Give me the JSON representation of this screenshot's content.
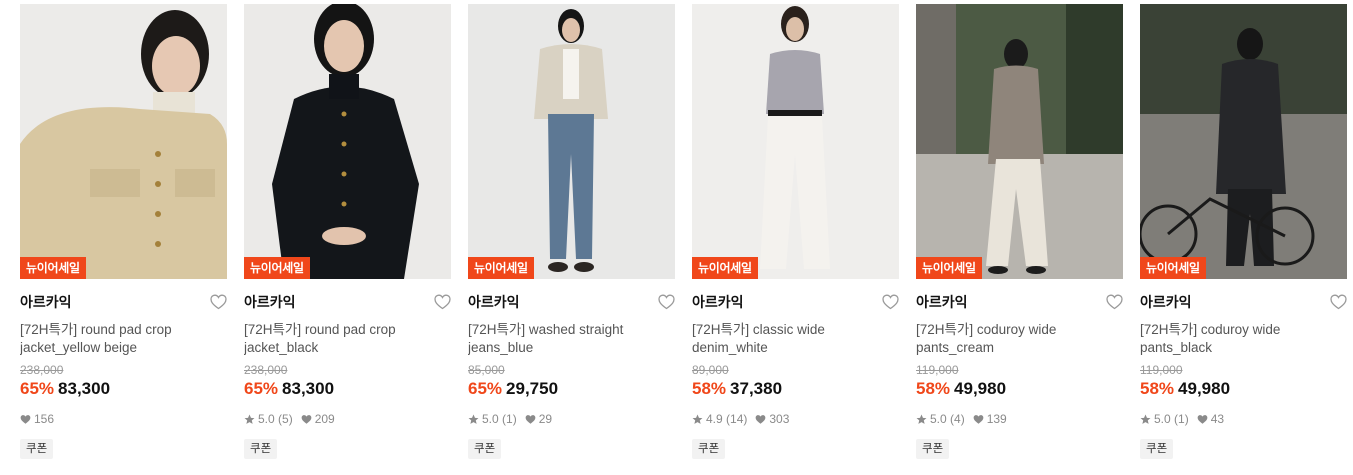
{
  "colors": {
    "accent": "#f0471a",
    "muted": "#8a8a8a"
  },
  "products": [
    {
      "badge": "뉴이어세일",
      "brand": "아르카익",
      "title": "[72H특가] round pad crop jacket_yellow beige",
      "original_price": "238,000",
      "discount": "65%",
      "price": "83,300",
      "rating": "",
      "reviews": "",
      "likes": "156",
      "coupon": "쿠폰"
    },
    {
      "badge": "뉴이어세일",
      "brand": "아르카익",
      "title": "[72H특가] round pad crop jacket_black",
      "original_price": "238,000",
      "discount": "65%",
      "price": "83,300",
      "rating": "5.0",
      "reviews": "(5)",
      "likes": "209",
      "coupon": "쿠폰"
    },
    {
      "badge": "뉴이어세일",
      "brand": "아르카익",
      "title": "[72H특가] washed straight jeans_blue",
      "original_price": "85,000",
      "discount": "65%",
      "price": "29,750",
      "rating": "5.0",
      "reviews": "(1)",
      "likes": "29",
      "coupon": "쿠폰"
    },
    {
      "badge": "뉴이어세일",
      "brand": "아르카익",
      "title": "[72H특가] classic wide denim_white",
      "original_price": "89,000",
      "discount": "58%",
      "price": "37,380",
      "rating": "4.9",
      "reviews": "(14)",
      "likes": "303",
      "coupon": "쿠폰"
    },
    {
      "badge": "뉴이어세일",
      "brand": "아르카익",
      "title": "[72H특가] coduroy wide pants_cream",
      "original_price": "119,000",
      "discount": "58%",
      "price": "49,980",
      "rating": "5.0",
      "reviews": "(4)",
      "likes": "139",
      "coupon": "쿠폰"
    },
    {
      "badge": "뉴이어세일",
      "brand": "아르카익",
      "title": "[72H특가] coduroy wide pants_black",
      "original_price": "119,000",
      "discount": "58%",
      "price": "49,980",
      "rating": "5.0",
      "reviews": "(1)",
      "likes": "43",
      "coupon": "쿠폰"
    }
  ]
}
